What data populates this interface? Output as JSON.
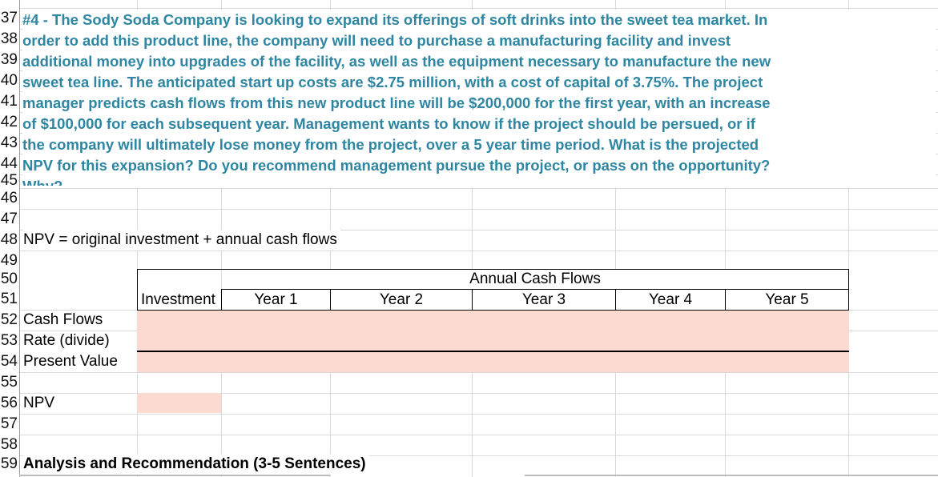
{
  "row_numbers": [
    "37",
    "38",
    "39",
    "40",
    "41",
    "42",
    "43",
    "44",
    "45",
    "46",
    "47",
    "48",
    "49",
    "50",
    "51",
    "52",
    "53",
    "54",
    "55",
    "56",
    "57",
    "58",
    "59"
  ],
  "question": {
    "lines": [
      "#4 - The Sody Soda Company is looking to expand its offerings of soft drinks into the sweet tea market. In",
      "order to add this product line, the company will need to purchase a manufacturing facility and invest",
      "additional money into upgrades of the facility, as well as the equipment necessary to manufacture the new",
      "sweet tea line. The anticipated start up costs are $2.75 million, with a cost of capital of 3.75%.  The project",
      "manager predicts cash flows from this new product line will be $200,000 for the first year, with an increase",
      "of $100,000 for each subsequent year.  Management wants to know if the project should be persued, or if",
      "the company will ultimately lose money from the project, over a 5 year time period.  What is the projected",
      "NPV for this expansion? Do you recommend management pursue the project, or pass on the opportunity?",
      "Why?"
    ]
  },
  "formula": "NPV = original investment + annual cash flows",
  "table": {
    "group_header": "Annual Cash Flows",
    "columns": [
      "Investment",
      "Year 1",
      "Year 2",
      "Year 3",
      "Year 4",
      "Year 5"
    ],
    "row_labels": [
      "Cash Flows",
      "Rate (divide)",
      "Present Value"
    ],
    "npv_label": "NPV",
    "input_fill_color": "#fcd9d1"
  },
  "analysis_heading": "Analysis and Recommendation (3-5 Sentences)"
}
